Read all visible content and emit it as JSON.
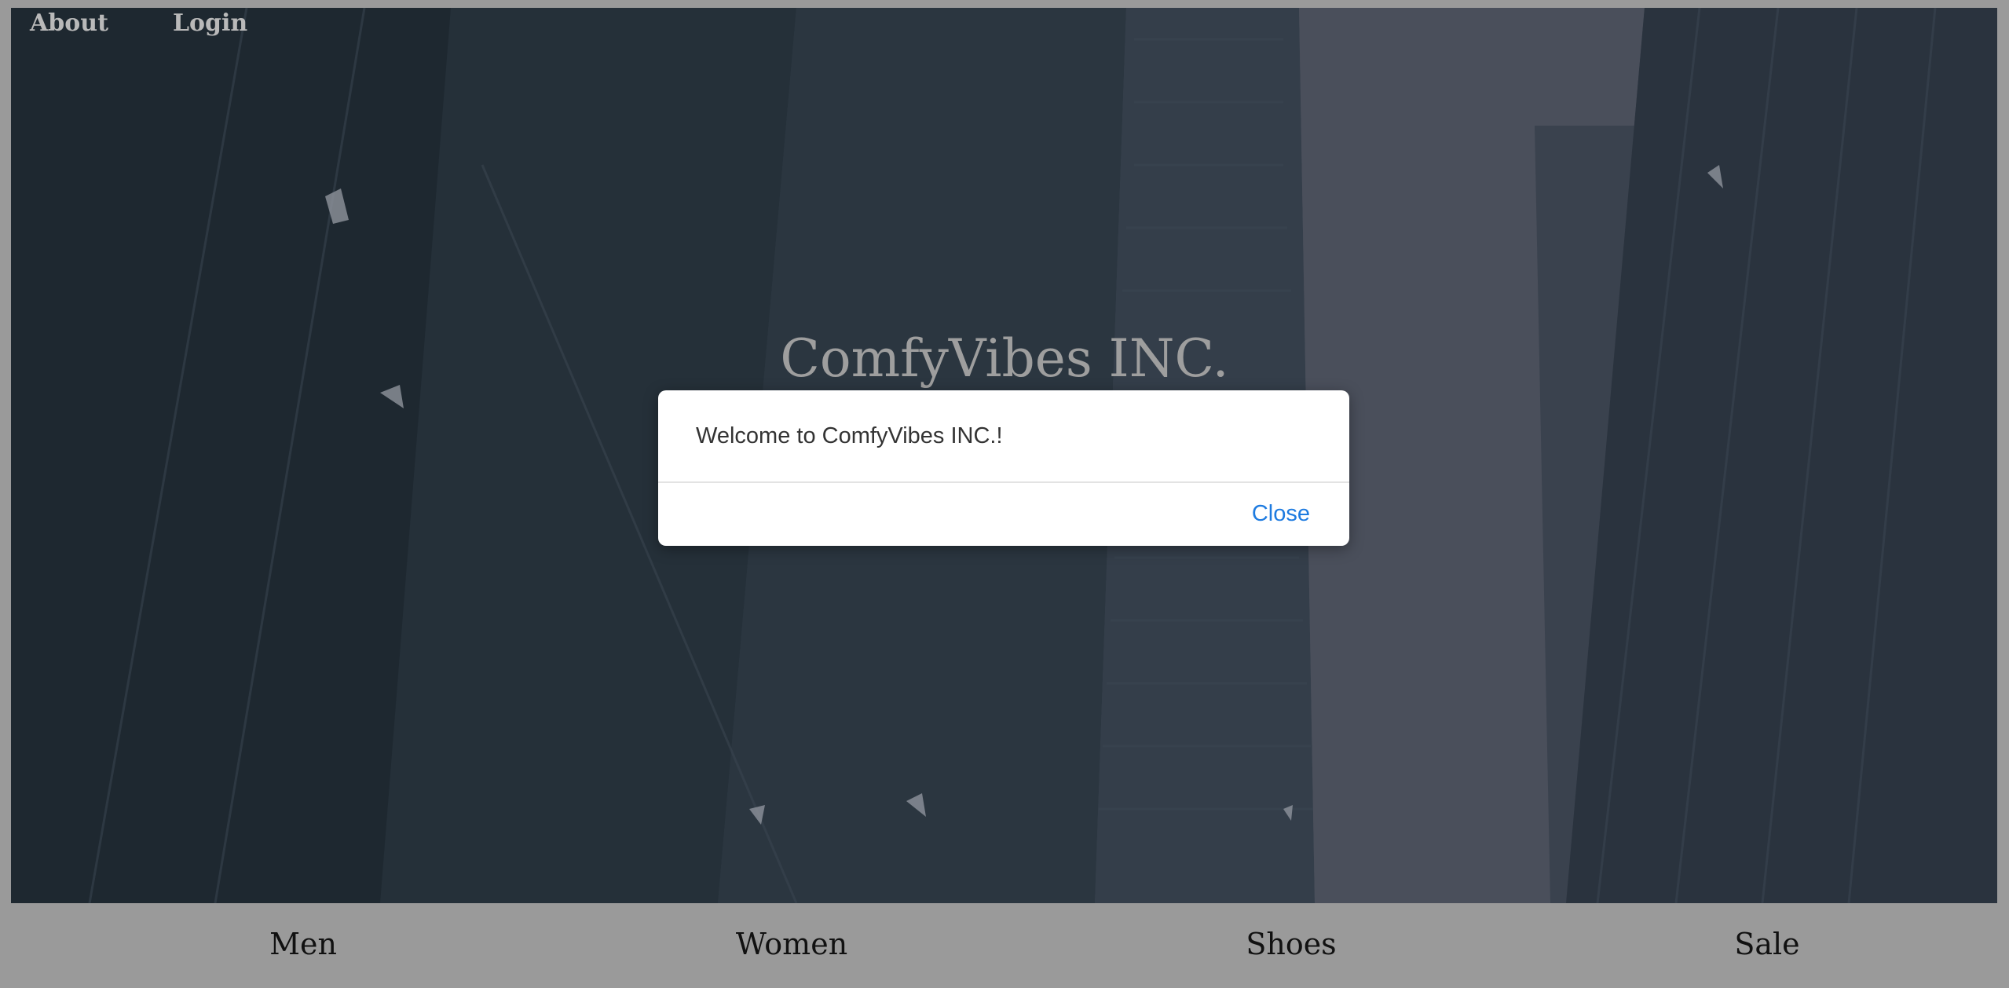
{
  "nav": {
    "about": "About",
    "login": "Login"
  },
  "hero": {
    "title": "ComfyVibes INC."
  },
  "modal": {
    "message": "Welcome to ComfyVibes INC.!",
    "close_label": "Close"
  },
  "categories": [
    "Men",
    "Women",
    "Shoes",
    "Sale"
  ],
  "colors": {
    "link_blue": "#1e7be0",
    "frame_gray": "#9a9a9a",
    "hero_dark": "#1f2a33"
  }
}
